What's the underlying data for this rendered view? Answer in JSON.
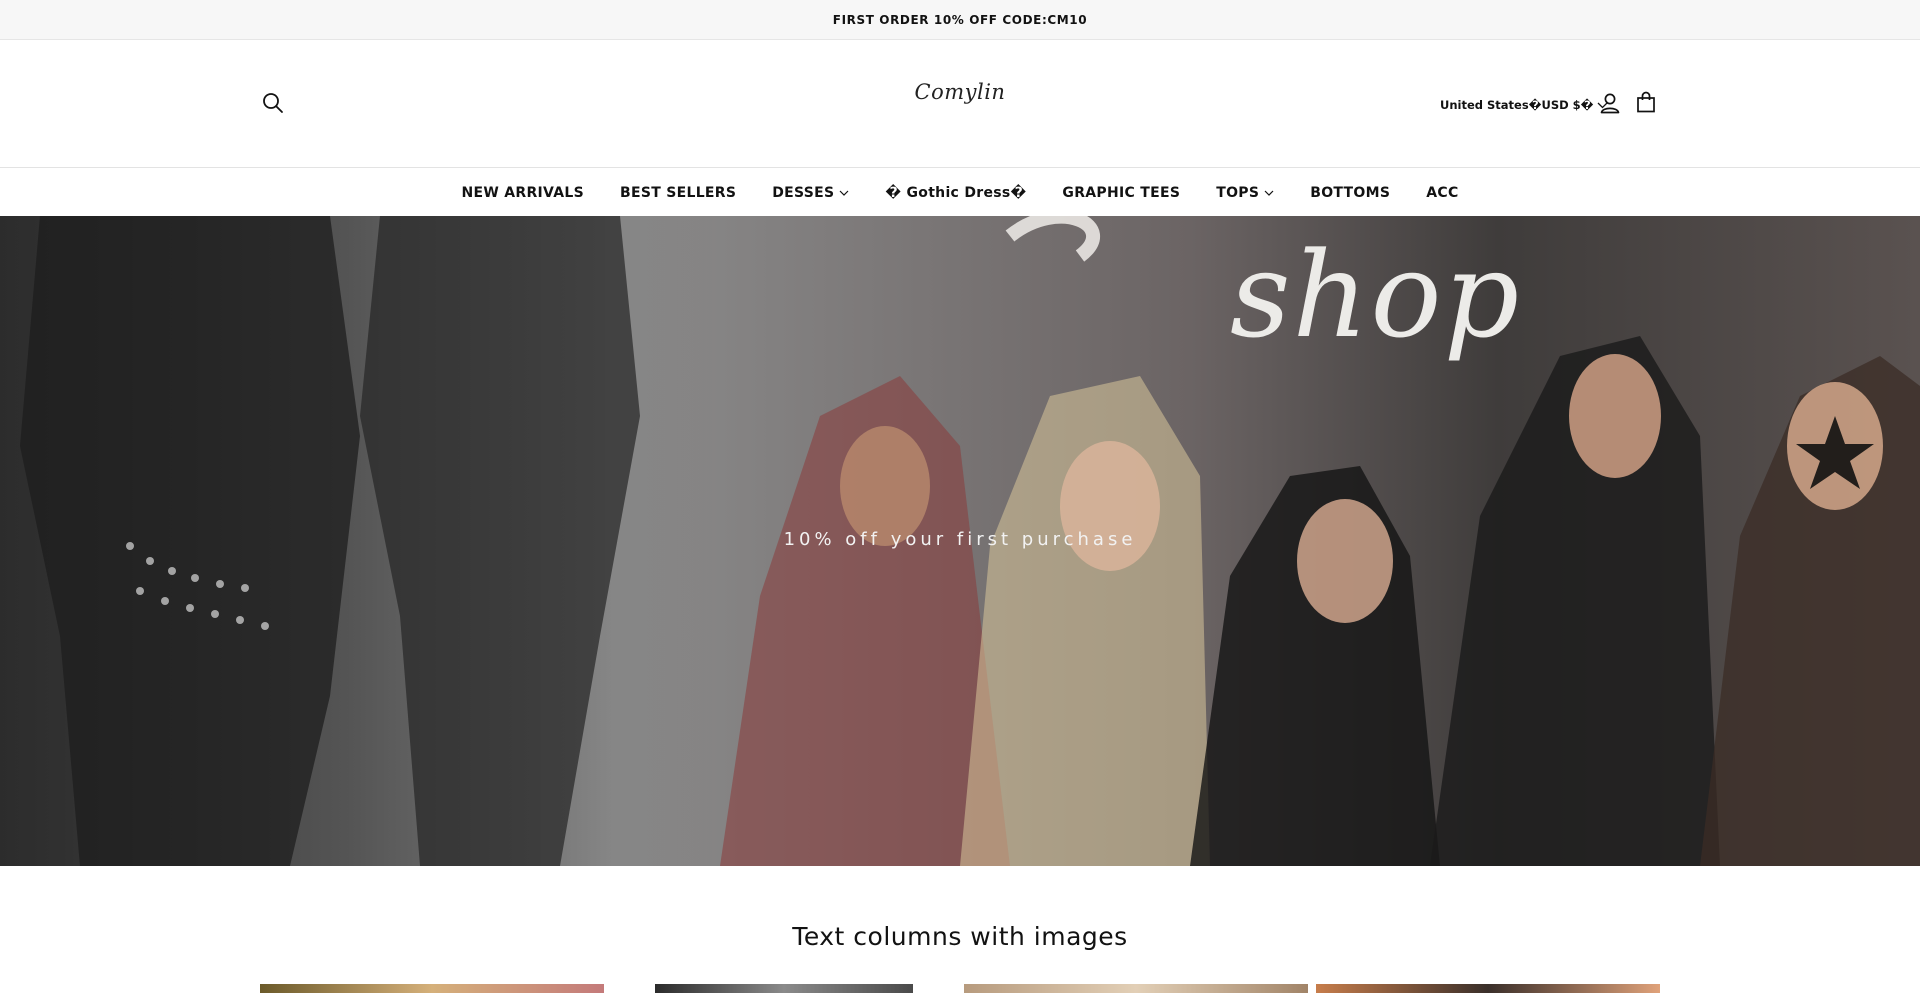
{
  "announcement": {
    "text": "FIRST ORDER 10% OFF CODE:CM10"
  },
  "header": {
    "logo": "Comylin",
    "locale": "United States�USD $�",
    "icons": {
      "search": "search-icon",
      "account": "user-icon",
      "cart": "shopping-bag-icon",
      "dropdown": "chevron-down-icon"
    }
  },
  "nav": {
    "items": [
      {
        "label": "NEW ARRIVALS",
        "dropdown": false
      },
      {
        "label": "BEST SELLERS",
        "dropdown": false
      },
      {
        "label": "DESSES",
        "dropdown": true
      },
      {
        "label": "� Gothic Dress�",
        "dropdown": false
      },
      {
        "label": "GRAPHIC TEES",
        "dropdown": false
      },
      {
        "label": "TOPS",
        "dropdown": true
      },
      {
        "label": "BOTTOMS",
        "dropdown": false
      },
      {
        "label": "ACC",
        "dropdown": false
      }
    ]
  },
  "hero": {
    "overlay_text": "10% off your first purchase",
    "script_text": "shop"
  },
  "section": {
    "title": "Text columns with images"
  },
  "colors": {
    "announcement_bg": "#f7f7f7",
    "text": "#121212",
    "hero_text": "#f2f2f2"
  }
}
